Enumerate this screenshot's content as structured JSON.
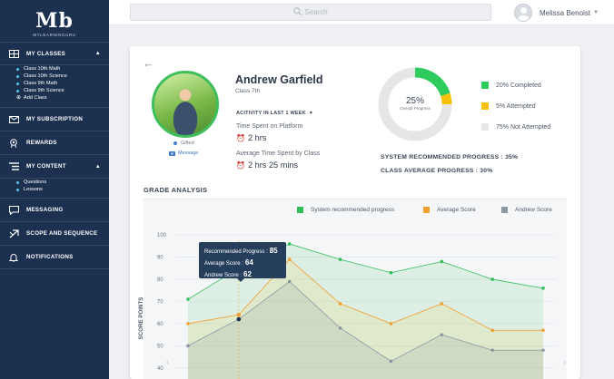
{
  "logo": {
    "mark": "Mb",
    "text": "MYLEARNINGURU"
  },
  "sidebar": {
    "items": [
      {
        "label": "MY CLASSES",
        "icon": "classes-icon"
      },
      {
        "label": "MY SUBSCRIPTION",
        "icon": "subscription-icon"
      },
      {
        "label": "REWARDS",
        "icon": "rewards-icon"
      },
      {
        "label": "MY CONTENT",
        "icon": "content-icon"
      },
      {
        "label": "MESSAGING",
        "icon": "messaging-icon"
      },
      {
        "label": "SCOPE AND SEQUENCE",
        "icon": "scope-icon"
      },
      {
        "label": "NOTIFICATIONS",
        "icon": "notifications-icon"
      }
    ],
    "classes": [
      "Class 10th Math",
      "Class 10th Science",
      "Class 9th Math",
      "Class 9th Science"
    ],
    "add_class": "Add Class",
    "content": [
      "Questions",
      "Lessons"
    ]
  },
  "search": {
    "placeholder": "Search"
  },
  "user": {
    "name": "Melissa Benoist"
  },
  "student": {
    "name": "Andrew Garfield",
    "class": "Class 7th",
    "badge": "Gifted",
    "message": "Message",
    "activity_filter": "ACITIVITY IN LAST 1 WEEK",
    "time_label": "Time Spent on Platform",
    "time_value": "2 hrs",
    "avg_label": "Average Time Spent by Class",
    "avg_value": "2 hrs 25 mins"
  },
  "progress": {
    "percent": "25%",
    "sub": "Overall Progress",
    "completed": 20,
    "attempted": 5,
    "not_attempted": 75,
    "legend": [
      "20% Completed",
      "5% Attempted",
      "75% Not Attempted"
    ],
    "colors": {
      "completed": "#2ecc5c",
      "attempted": "#f4c20d",
      "not_attempted": "#e6e6e6"
    },
    "system_label": "SYSTEM RECOMMENDED PROGRESS :",
    "system_value": "35%",
    "class_label": "CLASS AVERAGE PROGRESS :",
    "class_value": "30%"
  },
  "grade_analysis": {
    "title": "GRADE ANALYSIS"
  },
  "chart_data": {
    "type": "area",
    "ylabel": "SCORE POINTS",
    "yticks": [
      40,
      50,
      60,
      70,
      80,
      90,
      100
    ],
    "ylim": [
      35,
      105
    ],
    "x": [
      1,
      2,
      3,
      4,
      5,
      6,
      7,
      8
    ],
    "series": [
      {
        "name": "System recommended progress",
        "color": "#2ebd59",
        "values": [
          71,
          85,
          96,
          89,
          83,
          88,
          80,
          76
        ]
      },
      {
        "name": "Average Score",
        "color": "#f0a030",
        "values": [
          60,
          64,
          89,
          69,
          60,
          69,
          57,
          57
        ]
      },
      {
        "name": "Andrew Score",
        "color": "#8c97a4",
        "values": [
          50,
          62,
          79,
          58,
          43,
          55,
          48,
          48
        ]
      }
    ],
    "tooltip": {
      "recommended_label": "Recommended Progress :",
      "recommended_value": "85",
      "average_label": "Average Score :",
      "average_value": "64",
      "andrew_label": "Andrew Score :",
      "andrew_value": "62"
    }
  }
}
